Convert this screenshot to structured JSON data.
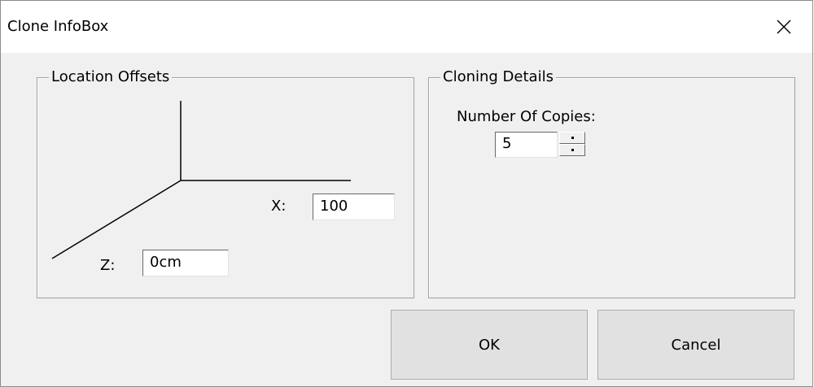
{
  "window": {
    "title": "Clone InfoBox",
    "close_icon": "close-icon"
  },
  "location_offsets": {
    "legend": "Location Offsets",
    "x_label": "X:",
    "x_value": "100",
    "z_label": "Z:",
    "z_value": "0cm"
  },
  "cloning_details": {
    "legend": "Cloning Details",
    "copies_label": "Number Of Copies:",
    "copies_value": "5"
  },
  "buttons": {
    "ok_label": "OK",
    "cancel_label": "Cancel"
  }
}
